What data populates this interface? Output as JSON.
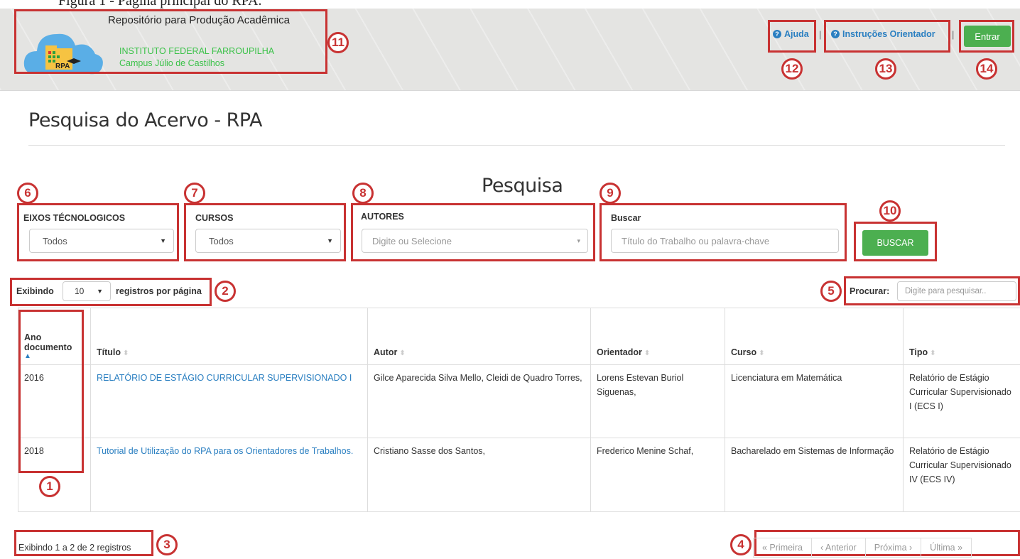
{
  "figure_caption": "Figura 1 - Página principal do RPA.",
  "header": {
    "logo_text": "RPA",
    "title": "Repositório para Produção Acadêmica",
    "institution": "INSTITUTO FEDERAL FARROUPILHA",
    "campus": "Campus Júlio de Castilhos",
    "nav": {
      "ajuda": "Ajuda",
      "separator": "|",
      "instrucoes": "Instruções Orientador",
      "entrar": "Entrar"
    }
  },
  "page_title": "Pesquisa do Acervo - RPA",
  "search": {
    "heading": "Pesquisa",
    "eixos": {
      "label": "EIXOS TÉCNOLOGICOS",
      "value": "Todos"
    },
    "cursos": {
      "label": "CURSOS",
      "value": "Todos"
    },
    "autores": {
      "label": "AUTORES",
      "placeholder": "Digite ou Selecione"
    },
    "buscar": {
      "label": "Buscar",
      "placeholder": "Título do Trabalho ou palavra-chave"
    },
    "button": "BUSCAR"
  },
  "table_controls": {
    "show_prefix": "Exibindo",
    "page_size": "10",
    "show_suffix": "registros por página",
    "filter_label": "Procurar:",
    "filter_placeholder": "Digite para pesquisar.."
  },
  "table": {
    "columns": [
      "Ano documento",
      "Título",
      "Autor",
      "Orientador",
      "Curso",
      "Tipo"
    ],
    "rows": [
      {
        "ano": "2016",
        "titulo": "RELATÓRIO DE ESTÁGIO CURRICULAR SUPERVISIONADO I",
        "autor": "Gilce Aparecida Silva Mello, Cleidi de Quadro Torres,",
        "orientador": "Lorens Estevan Buriol Siguenas,",
        "curso": "Licenciatura em Matemática",
        "tipo": "Relatório de Estágio Curricular Supervisionado I (ECS I)"
      },
      {
        "ano": "2018",
        "titulo": "Tutorial de Utilização do RPA para os Orientadores de Trabalhos.",
        "autor": "Cristiano Sasse dos Santos,",
        "orientador": "Frederico Menine Schaf,",
        "curso": "Bacharelado em Sistemas de Informação",
        "tipo": "Relatório de Estágio Curricular Supervisionado IV (ECS IV)"
      }
    ]
  },
  "footer": {
    "info": "Exibindo 1 a 2 de 2 registros",
    "pager": [
      "« Primeira",
      "‹ Anterior",
      "Próxima ›",
      "Última »"
    ]
  },
  "callout_numbers": [
    "1",
    "2",
    "3",
    "4",
    "5",
    "6",
    "7",
    "8",
    "9",
    "10",
    "11",
    "12",
    "13",
    "14"
  ],
  "colors": {
    "accent_green": "#4caf50",
    "link_blue": "#2a7fc1",
    "callout_red": "#c83232",
    "brand_green": "#3cc24a"
  }
}
